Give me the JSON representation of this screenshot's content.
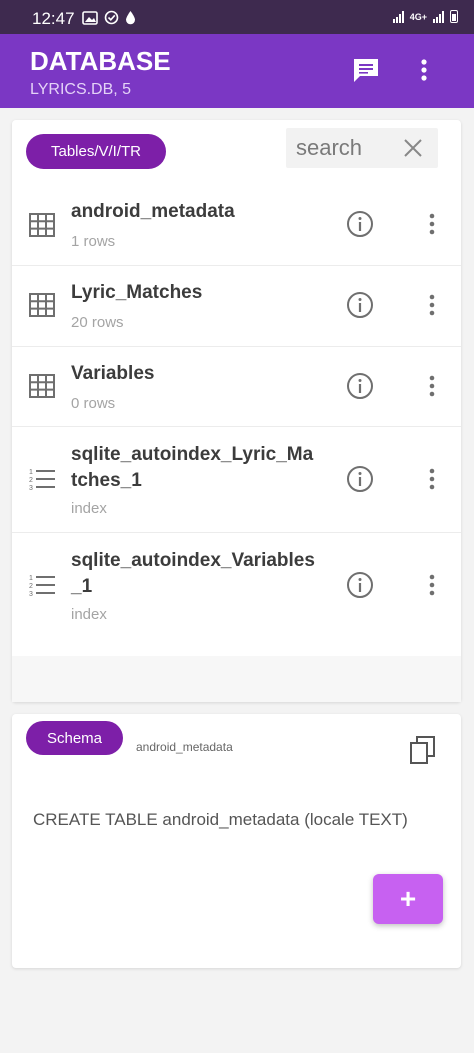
{
  "status_bar": {
    "time": "12:47",
    "left_icons": [
      "gallery-icon",
      "check-circle-icon",
      "drop-icon"
    ],
    "network_label": "4G+"
  },
  "app_bar": {
    "title": "DATABASE",
    "subtitle": "LYRICS.DB, 5",
    "background_color": "#7b37c4",
    "icons": [
      "message-icon",
      "more-vert-icon"
    ]
  },
  "tables_panel": {
    "filter_chip": "Tables/V/I/TR",
    "search_placeholder": "search",
    "rows": [
      {
        "name": "android_metadata",
        "sub": "1 rows",
        "kind": "table"
      },
      {
        "name": "Lyric_Matches",
        "sub": "20 rows",
        "kind": "table"
      },
      {
        "name": "Variables",
        "sub": "0 rows",
        "kind": "table"
      },
      {
        "name": "sqlite_autoindex_Lyric_Ma tches_1",
        "sub": "index",
        "kind": "index"
      },
      {
        "name": "sqlite_autoindex_Variables _1",
        "sub": "index",
        "kind": "index"
      }
    ]
  },
  "schema_panel": {
    "chip": "Schema",
    "table_name": "android_metadata",
    "sql": "CREATE TABLE android_metadata (locale TEXT)"
  },
  "fab": {
    "label": "+",
    "color": "#c761f1"
  },
  "colors": {
    "accent": "#7b37c4",
    "chip": "#7d1fa8",
    "icon_gray": "#6f6f6f"
  }
}
